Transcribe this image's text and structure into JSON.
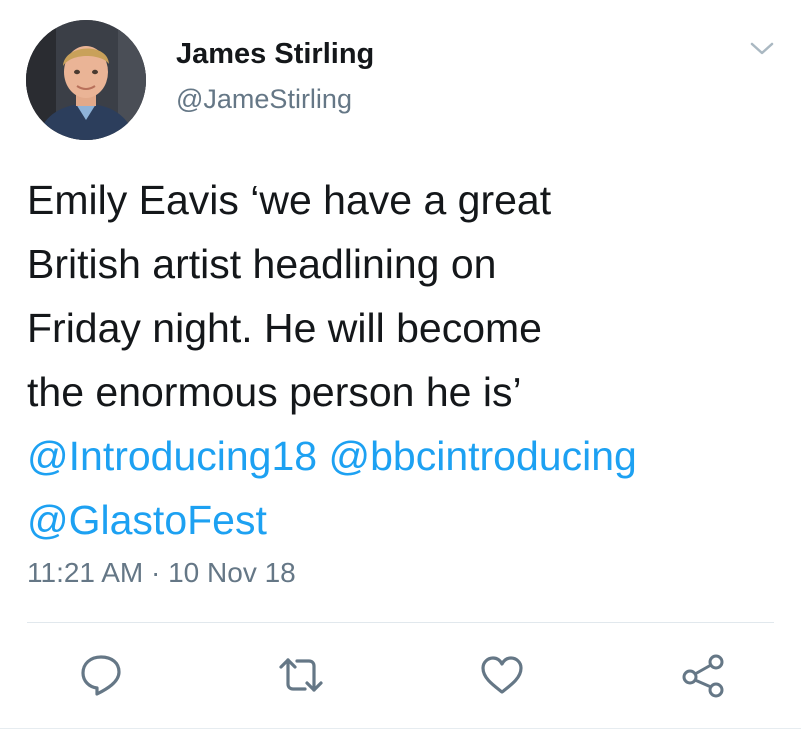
{
  "user": {
    "display_name": "James Stirling",
    "handle": "@JameStirling"
  },
  "tweet": {
    "lines": [
      "Emily Eavis ‘we have a great",
      "British artist headlining on",
      "Friday night. He will become",
      "the enormous person he is’"
    ],
    "mentions": [
      "@Introducing18",
      "@bbcintroducing",
      "@GlastoFest"
    ],
    "timestamp": "11:21 AM · 10 Nov 18"
  },
  "actions": {
    "reply_icon": "reply-icon",
    "retweet_icon": "retweet-icon",
    "like_icon": "heart-icon",
    "share_icon": "share-icon"
  },
  "colors": {
    "text": "#14171a",
    "secondary_text": "#657786",
    "link": "#1da1f2",
    "divider": "#e1e8ed"
  }
}
